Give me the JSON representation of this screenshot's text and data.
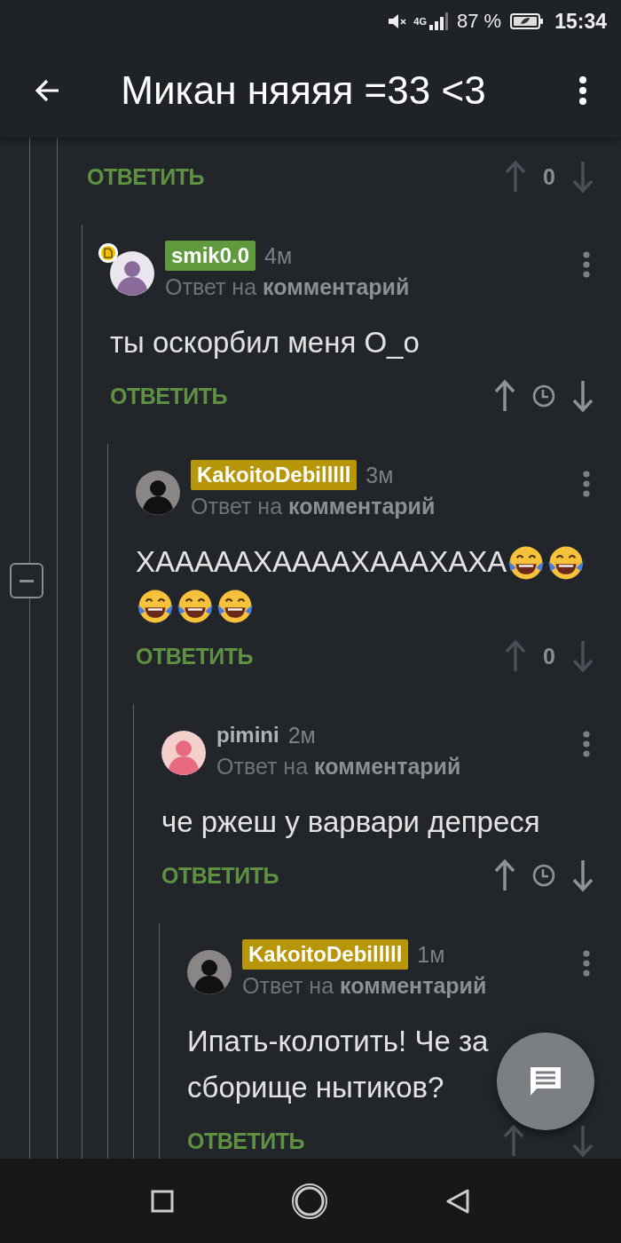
{
  "status_bar": {
    "network": "4G",
    "battery": "87 %",
    "time": "15:34"
  },
  "app_bar": {
    "title": "Микан няяяя =33 <3"
  },
  "thread": {
    "footer": {
      "reply": "ОТВЕТИТЬ",
      "vote": {
        "kind": "score",
        "rating": "0"
      }
    },
    "children": [
      {
        "author": "smik0.0",
        "color": "#5f9a3e",
        "badge": true,
        "time": "4м",
        "reply_to": "Ответ на **комментарий**",
        "body": [
          {
            "kind": "text",
            "text": "ты оскорбил меня О_о"
          }
        ],
        "footer": {
          "reply": "ОТВЕТИТЬ",
          "vote": {
            "kind": "timer"
          }
        },
        "children": [
          {
            "author": "KakoitoDebilllll",
            "color": "#b8960a",
            "time": "3м",
            "reply_to": "Ответ на **комментарий**",
            "body": [
              {
                "kind": "text",
                "text": "ХАААААХААААХАААХАХА"
              },
              {
                "kind": "emoji"
              },
              {
                "kind": "emoji"
              },
              {
                "kind": "emoji"
              },
              {
                "kind": "emoji"
              },
              {
                "kind": "emoji"
              }
            ],
            "footer": {
              "reply": "ОТВЕТИТЬ",
              "vote": {
                "kind": "score",
                "rating": "0"
              }
            },
            "children": [
              {
                "author": "pimini",
                "time": "2м",
                "reply_to": "Ответ на **комментарий**",
                "body": [
                  {
                    "kind": "text",
                    "text": "че ржеш у варвари депреся"
                  }
                ],
                "footer": {
                  "reply": "ОТВЕТИТЬ",
                  "vote": {
                    "kind": "timer"
                  }
                },
                "children": [
                  {
                    "author": "KakoitoDebilllll",
                    "color": "#b8960a",
                    "time": "1м",
                    "reply_to": "Ответ на **комментарий**",
                    "body": [
                      {
                        "kind": "text",
                        "text": "Ипать-колотить! Че за сборище нытиков?"
                      }
                    ],
                    "footer": {
                      "reply": "ОТВЕТИТЬ",
                      "vote": {
                        "kind": "score"
                      }
                    }
                  }
                ]
              }
            ]
          }
        ]
      }
    ]
  }
}
